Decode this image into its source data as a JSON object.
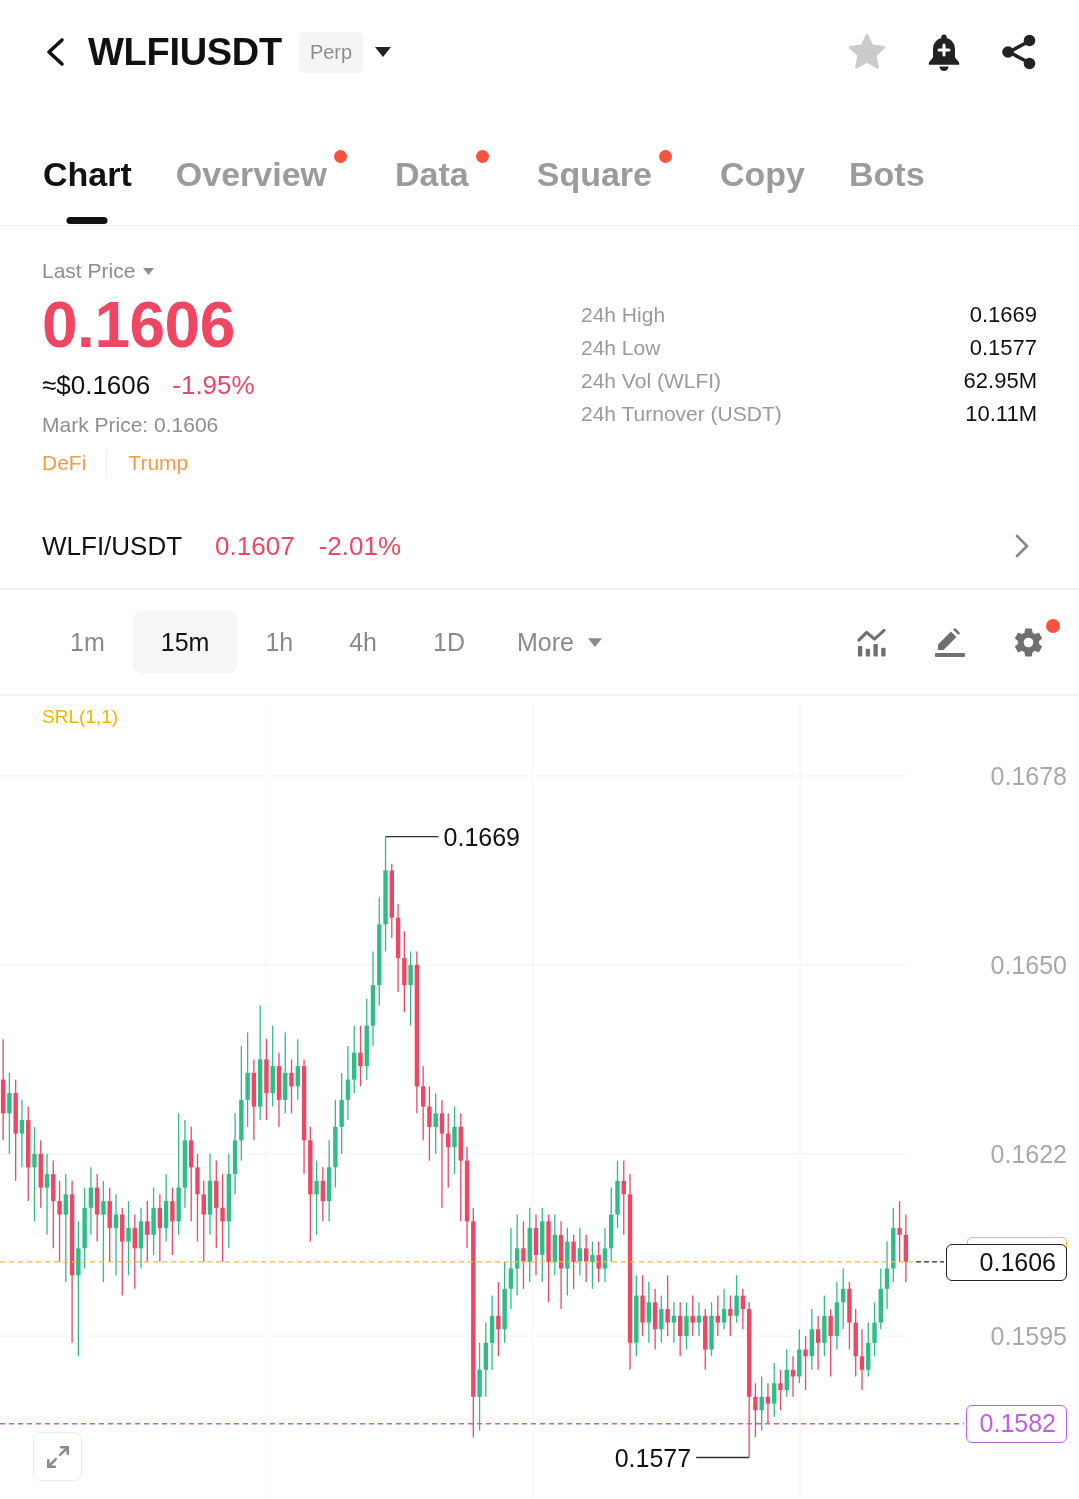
{
  "header": {
    "title": "WLFIUSDT",
    "badge": "Perp",
    "starred": false
  },
  "tabs": [
    {
      "label": "Chart",
      "selected": true,
      "dot": false
    },
    {
      "label": "Overview",
      "selected": false,
      "dot": true
    },
    {
      "label": "Data",
      "selected": false,
      "dot": true
    },
    {
      "label": "Square",
      "selected": false,
      "dot": true
    },
    {
      "label": "Copy",
      "selected": false,
      "dot": false
    },
    {
      "label": "Bots",
      "selected": false,
      "dot": false
    }
  ],
  "price": {
    "label": "Last Price",
    "value": "0.1606",
    "usd": "≈$0.1606",
    "change": "-1.95%",
    "mark": "Mark Price: 0.1606",
    "tags": [
      "DeFi",
      "Trump"
    ]
  },
  "stats": [
    {
      "label": "24h High",
      "value": "0.1669"
    },
    {
      "label": "24h Low",
      "value": "0.1577"
    },
    {
      "label": "24h Vol (WLFI)",
      "value": "62.95M"
    },
    {
      "label": "24h Turnover (USDT)",
      "value": "10.11M"
    }
  ],
  "spot": {
    "pair": "WLFI/USDT",
    "price": "0.1607",
    "change": "-2.01%"
  },
  "intervals": [
    {
      "label": "1m",
      "selected": false
    },
    {
      "label": "15m",
      "selected": true
    },
    {
      "label": "1h",
      "selected": false
    },
    {
      "label": "4h",
      "selected": false
    },
    {
      "label": "1D",
      "selected": false
    }
  ],
  "more": {
    "label": "More"
  },
  "settings_dot": true,
  "chart": {
    "indicator": "SRL(1,1)",
    "chart_data": {
      "type": "candlestick",
      "grid": true,
      "ohlc": [
        [
          0.1633,
          0.1639,
          0.1624,
          0.1628
        ],
        [
          0.1628,
          0.1634,
          0.1622,
          0.1631
        ],
        [
          0.1631,
          0.1633,
          0.1618,
          0.1625
        ],
        [
          0.1625,
          0.163,
          0.162,
          0.1627
        ],
        [
          0.1627,
          0.1629,
          0.1615,
          0.162
        ],
        [
          0.162,
          0.1626,
          0.1612,
          0.1622
        ],
        [
          0.1622,
          0.1624,
          0.1614,
          0.1617
        ],
        [
          0.1617,
          0.1622,
          0.161,
          0.1619
        ],
        [
          0.1619,
          0.1621,
          0.1608,
          0.1615
        ],
        [
          0.1615,
          0.1618,
          0.1606,
          0.1613
        ],
        [
          0.1613,
          0.1619,
          0.1603,
          0.1616
        ],
        [
          0.1616,
          0.1618,
          0.1594,
          0.1604
        ],
        [
          0.1604,
          0.1612,
          0.1592,
          0.1608
        ],
        [
          0.1608,
          0.1617,
          0.1605,
          0.1614
        ],
        [
          0.1614,
          0.162,
          0.161,
          0.1617
        ],
        [
          0.1617,
          0.1619,
          0.1609,
          0.1613
        ],
        [
          0.1613,
          0.1618,
          0.1603,
          0.1615
        ],
        [
          0.1615,
          0.1617,
          0.1606,
          0.1611
        ],
        [
          0.1611,
          0.1616,
          0.1604,
          0.1613
        ],
        [
          0.1613,
          0.1614,
          0.1601,
          0.1609
        ],
        [
          0.1609,
          0.1615,
          0.1604,
          0.1611
        ],
        [
          0.1611,
          0.1613,
          0.1602,
          0.1608
        ],
        [
          0.1608,
          0.1614,
          0.1605,
          0.1612
        ],
        [
          0.1612,
          0.1615,
          0.1606,
          0.161
        ],
        [
          0.161,
          0.1617,
          0.1607,
          0.1614
        ],
        [
          0.1614,
          0.1616,
          0.1606,
          0.1611
        ],
        [
          0.1611,
          0.1619,
          0.1609,
          0.1615
        ],
        [
          0.1615,
          0.1617,
          0.1607,
          0.1612
        ],
        [
          0.1612,
          0.1628,
          0.161,
          0.1617
        ],
        [
          0.1617,
          0.1627,
          0.1614,
          0.1624
        ],
        [
          0.1624,
          0.1626,
          0.1612,
          0.162
        ],
        [
          0.162,
          0.1622,
          0.1609,
          0.1616
        ],
        [
          0.1616,
          0.1618,
          0.1606,
          0.1613
        ],
        [
          0.1613,
          0.1622,
          0.161,
          0.1618
        ],
        [
          0.1618,
          0.1621,
          0.1608,
          0.1614
        ],
        [
          0.1614,
          0.1619,
          0.1606,
          0.1612
        ],
        [
          0.1612,
          0.1622,
          0.1608,
          0.1619
        ],
        [
          0.1619,
          0.1628,
          0.1616,
          0.1624
        ],
        [
          0.1624,
          0.1638,
          0.1621,
          0.163
        ],
        [
          0.163,
          0.164,
          0.1626,
          0.1634
        ],
        [
          0.1634,
          0.1636,
          0.1624,
          0.1629
        ],
        [
          0.1629,
          0.1644,
          0.1627,
          0.1636
        ],
        [
          0.1636,
          0.1639,
          0.1627,
          0.1631
        ],
        [
          0.1631,
          0.1641,
          0.1629,
          0.1635
        ],
        [
          0.1635,
          0.1637,
          0.1626,
          0.163
        ],
        [
          0.163,
          0.164,
          0.1628,
          0.1634
        ],
        [
          0.1634,
          0.1636,
          0.1628,
          0.1632
        ],
        [
          0.1632,
          0.1639,
          0.163,
          0.1635
        ],
        [
          0.1635,
          0.1636,
          0.1619,
          0.1624
        ],
        [
          0.1624,
          0.1626,
          0.1609,
          0.1616
        ],
        [
          0.1616,
          0.1621,
          0.161,
          0.1618
        ],
        [
          0.1618,
          0.162,
          0.1612,
          0.1615
        ],
        [
          0.1615,
          0.1624,
          0.1612,
          0.162
        ],
        [
          0.162,
          0.163,
          0.1617,
          0.1626
        ],
        [
          0.1626,
          0.1634,
          0.1622,
          0.163
        ],
        [
          0.163,
          0.1638,
          0.1627,
          0.1633
        ],
        [
          0.1633,
          0.1641,
          0.1631,
          0.1637
        ],
        [
          0.1637,
          0.1641,
          0.1632,
          0.1635
        ],
        [
          0.1635,
          0.1645,
          0.1633,
          0.1641
        ],
        [
          0.1641,
          0.1652,
          0.1638,
          0.1647
        ],
        [
          0.1647,
          0.166,
          0.1644,
          0.1656
        ],
        [
          0.1656,
          0.1669,
          0.1652,
          0.1664
        ],
        [
          0.1664,
          0.1665,
          0.1654,
          0.1657
        ],
        [
          0.1657,
          0.1659,
          0.1646,
          0.1651
        ],
        [
          0.1651,
          0.1655,
          0.1643,
          0.1647
        ],
        [
          0.1647,
          0.1652,
          0.1641,
          0.165
        ],
        [
          0.165,
          0.1652,
          0.1628,
          0.1632
        ],
        [
          0.1632,
          0.1635,
          0.1624,
          0.1629
        ],
        [
          0.1629,
          0.1632,
          0.1621,
          0.1626
        ],
        [
          0.1626,
          0.1631,
          0.1622,
          0.1628
        ],
        [
          0.1628,
          0.163,
          0.1614,
          0.1625
        ],
        [
          0.1625,
          0.1628,
          0.1617,
          0.1623
        ],
        [
          0.1623,
          0.1629,
          0.1619,
          0.1626
        ],
        [
          0.1626,
          0.1628,
          0.1612,
          0.1621
        ],
        [
          0.1621,
          0.1623,
          0.1608,
          0.1612
        ],
        [
          0.1612,
          0.1614,
          0.158,
          0.1586
        ],
        [
          0.1586,
          0.1594,
          0.1581,
          0.159
        ],
        [
          0.159,
          0.1597,
          0.1586,
          0.1594
        ],
        [
          0.1594,
          0.1601,
          0.159,
          0.1598
        ],
        [
          0.1598,
          0.1603,
          0.1592,
          0.1596
        ],
        [
          0.1596,
          0.1606,
          0.1594,
          0.1602
        ],
        [
          0.1602,
          0.1611,
          0.1599,
          0.1605
        ],
        [
          0.1605,
          0.1613,
          0.1601,
          0.1608
        ],
        [
          0.1608,
          0.1612,
          0.1602,
          0.1606
        ],
        [
          0.1606,
          0.1614,
          0.1603,
          0.1611
        ],
        [
          0.1611,
          0.1613,
          0.1604,
          0.1607
        ],
        [
          0.1607,
          0.1614,
          0.1603,
          0.1612
        ],
        [
          0.1612,
          0.1613,
          0.16,
          0.1606
        ],
        [
          0.1606,
          0.1613,
          0.1604,
          0.161
        ],
        [
          0.161,
          0.1612,
          0.1599,
          0.1605
        ],
        [
          0.1605,
          0.1611,
          0.1601,
          0.1609
        ],
        [
          0.1609,
          0.161,
          0.1602,
          0.1606
        ],
        [
          0.1606,
          0.1611,
          0.1604,
          0.1608
        ],
        [
          0.1608,
          0.161,
          0.1603,
          0.1606
        ],
        [
          0.1606,
          0.1609,
          0.1602,
          0.1607
        ],
        [
          0.1607,
          0.1609,
          0.1603,
          0.1605
        ],
        [
          0.1605,
          0.1611,
          0.1603,
          0.1608
        ],
        [
          0.1608,
          0.1617,
          0.1606,
          0.1613
        ],
        [
          0.1613,
          0.1621,
          0.1611,
          0.1618
        ],
        [
          0.1618,
          0.1621,
          0.161,
          0.1616
        ],
        [
          0.1616,
          0.1619,
          0.159,
          0.1594
        ],
        [
          0.1594,
          0.1604,
          0.1592,
          0.1601
        ],
        [
          0.1601,
          0.1604,
          0.1595,
          0.1597
        ],
        [
          0.1597,
          0.1603,
          0.1594,
          0.16
        ],
        [
          0.16,
          0.1602,
          0.1593,
          0.1596
        ],
        [
          0.1596,
          0.1601,
          0.1594,
          0.1599
        ],
        [
          0.1599,
          0.1604,
          0.1595,
          0.1597
        ],
        [
          0.1597,
          0.16,
          0.1594,
          0.1598
        ],
        [
          0.1598,
          0.16,
          0.1592,
          0.1595
        ],
        [
          0.1595,
          0.16,
          0.1593,
          0.1598
        ],
        [
          0.1598,
          0.1601,
          0.1595,
          0.1597
        ],
        [
          0.1597,
          0.16,
          0.1595,
          0.1598
        ],
        [
          0.1598,
          0.1599,
          0.159,
          0.1593
        ],
        [
          0.1593,
          0.16,
          0.1592,
          0.1598
        ],
        [
          0.1598,
          0.1601,
          0.1595,
          0.1597
        ],
        [
          0.1597,
          0.1602,
          0.1596,
          0.1599
        ],
        [
          0.1599,
          0.1601,
          0.1595,
          0.1598
        ],
        [
          0.1598,
          0.1604,
          0.1597,
          0.1601
        ],
        [
          0.1601,
          0.1602,
          0.1596,
          0.1599
        ],
        [
          0.1599,
          0.16,
          0.1577,
          0.1586
        ],
        [
          0.1586,
          0.1588,
          0.158,
          0.1584
        ],
        [
          0.1584,
          0.1589,
          0.1581,
          0.1586
        ],
        [
          0.1586,
          0.1588,
          0.1582,
          0.1585
        ],
        [
          0.1585,
          0.1591,
          0.1583,
          0.1588
        ],
        [
          0.1588,
          0.159,
          0.1584,
          0.1587
        ],
        [
          0.1587,
          0.1593,
          0.1586,
          0.159
        ],
        [
          0.159,
          0.1592,
          0.1586,
          0.1589
        ],
        [
          0.1589,
          0.1596,
          0.1588,
          0.1593
        ],
        [
          0.1593,
          0.1595,
          0.1587,
          0.1592
        ],
        [
          0.1592,
          0.1599,
          0.159,
          0.1596
        ],
        [
          0.1596,
          0.1598,
          0.159,
          0.1594
        ],
        [
          0.1594,
          0.1601,
          0.1592,
          0.1598
        ],
        [
          0.1598,
          0.1599,
          0.1589,
          0.1595
        ],
        [
          0.1595,
          0.1603,
          0.1593,
          0.16
        ],
        [
          0.16,
          0.1605,
          0.1596,
          0.1602
        ],
        [
          0.1602,
          0.1603,
          0.1593,
          0.1597
        ],
        [
          0.1597,
          0.1599,
          0.1589,
          0.1592
        ],
        [
          0.1592,
          0.1596,
          0.1587,
          0.159
        ],
        [
          0.159,
          0.1597,
          0.1589,
          0.1594
        ],
        [
          0.1594,
          0.16,
          0.1592,
          0.1597
        ],
        [
          0.1597,
          0.1605,
          0.1596,
          0.1602
        ],
        [
          0.1602,
          0.1609,
          0.1599,
          0.1605
        ],
        [
          0.1605,
          0.1614,
          0.1603,
          0.1611
        ],
        [
          0.1611,
          0.1615,
          0.1606,
          0.161
        ],
        [
          0.161,
          0.1613,
          0.1603,
          0.1606
        ]
      ],
      "ylim": [
        0.1571,
        0.169
      ],
      "yticks": [
        {
          "value": 0.1678,
          "label": "0.1678"
        },
        {
          "value": 0.165,
          "label": "0.1650"
        },
        {
          "value": 0.1622,
          "label": "0.1622"
        },
        {
          "value": 0.1595,
          "label": "0.1595"
        }
      ],
      "annotations": [
        "0.1669",
        "0.1577"
      ],
      "ref_lines": [
        {
          "axis": "y",
          "value": 0.1606,
          "label": "0.1606",
          "color": "#f0c030"
        },
        {
          "axis": "y",
          "value": 0.1582,
          "label": "0.1582",
          "color": "#c35de3"
        }
      ]
    }
  }
}
